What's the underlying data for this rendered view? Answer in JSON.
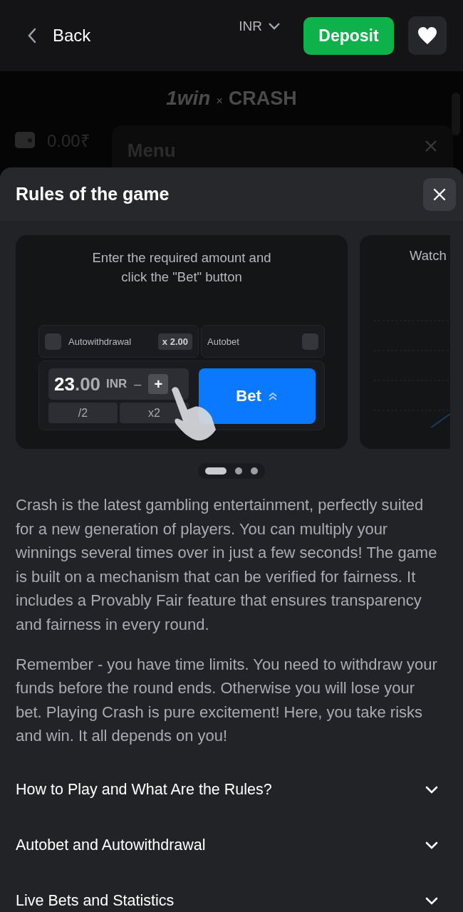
{
  "header": {
    "back": "Back",
    "currency": "INR",
    "deposit": "Deposit"
  },
  "background": {
    "logo_left": "1win",
    "logo_sep": "×",
    "logo_right": "CRASH",
    "balance": "0.00₹",
    "menu_title": "Menu"
  },
  "sheet": {
    "title": "Rules of the game",
    "slides": [
      {
        "kind": "bet-demo",
        "caption": "Enter the required amount and click the \"Bet\" button",
        "autowithdrawal": {
          "label": "Autowithdrawal",
          "checked": false,
          "multiplier": "x 2.00"
        },
        "autobet": {
          "label": "Autobet",
          "checked": false
        },
        "amount_whole": "23",
        "amount_decimals": ".00",
        "amount_currency": "INR",
        "minus": "–",
        "plus": "+",
        "half": "/2",
        "double": "x2",
        "bet": "Bet"
      },
      {
        "kind": "chart-demo",
        "caption": "Watch"
      }
    ],
    "dots": [
      {
        "selected": true
      },
      {
        "selected": false
      },
      {
        "selected": false
      }
    ],
    "paragraphs": [
      "Crash is the latest gambling entertainment, perfectly suited for a new generation of players. You can multiply your winnings several times over in just a few seconds! The game is built on a mechanism that can be verified for fairness. It includes a Provably Fair feature that ensures transparency and fairness in every round.",
      "Remember - you have time limits. You need to withdraw your funds before the round ends. Otherwise you will lose your bet. Playing Crash is pure excitement! Here, you take risks and win. It all depends on you!"
    ],
    "sections": [
      {
        "title": "How to Play and What Are the Rules?",
        "expanded": false
      },
      {
        "title": "Autobet and Autowithdrawal",
        "expanded": false
      },
      {
        "title": "Live Bets and Statistics",
        "expanded": false
      }
    ]
  }
}
